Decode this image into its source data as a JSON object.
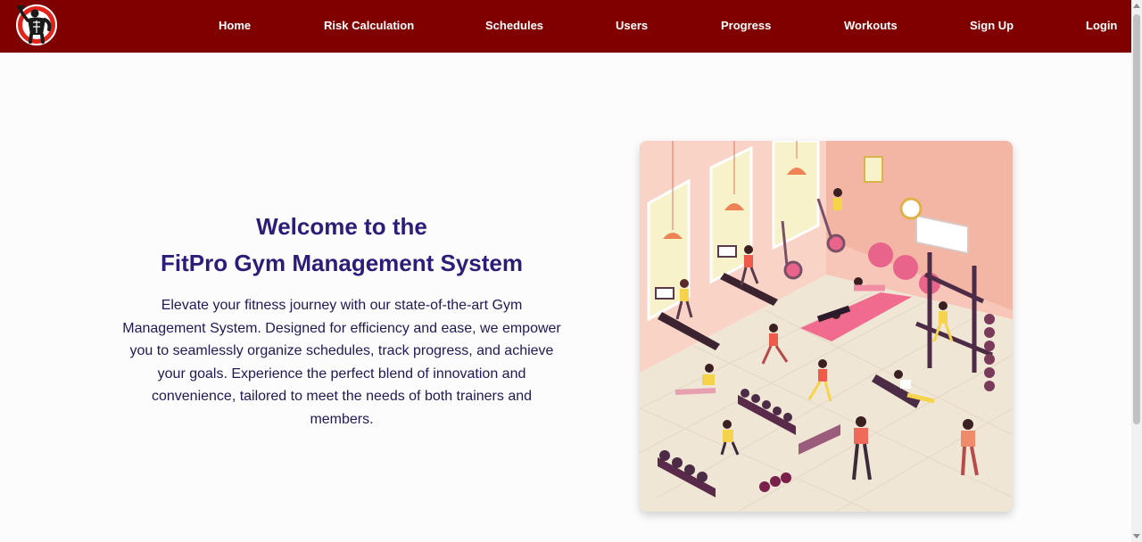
{
  "brand": {
    "logo_icon": "bodybuilder-logo-icon",
    "colors": {
      "navbar": "#800000",
      "heading": "#2e1d78",
      "body_text": "#1d1a55"
    }
  },
  "nav": {
    "items": [
      {
        "label": "Home"
      },
      {
        "label": "Risk Calculation"
      },
      {
        "label": "Schedules"
      },
      {
        "label": "Users"
      },
      {
        "label": "Progress"
      },
      {
        "label": "Workouts"
      },
      {
        "label": "Sign Up"
      },
      {
        "label": "Login"
      }
    ]
  },
  "hero": {
    "title_line1": "Welcome to the",
    "title_line2": "FitPro Gym Management System",
    "description": "Elevate your fitness journey with our state-of-the-art Gym Management System. Designed for efficiency and ease, we empower you to seamlessly organize schedules, track progress, and achieve your goals. Experience the perfect blend of innovation and convenience, tailored to meet the needs of both trainers and members.",
    "illustration_icon": "gym-interior-illustration"
  }
}
